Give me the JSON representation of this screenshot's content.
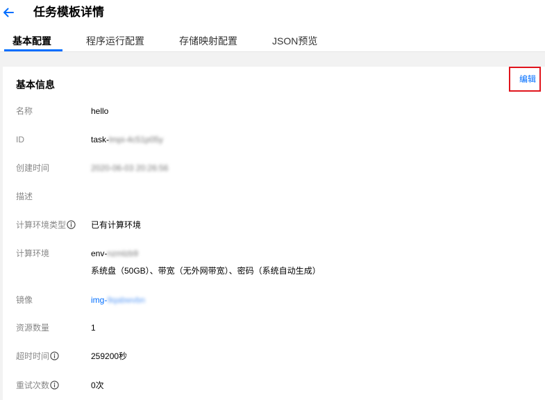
{
  "header": {
    "title": "任务模板详情"
  },
  "tabs": [
    {
      "label": "基本配置",
      "active": true
    },
    {
      "label": "程序运行配置",
      "active": false
    },
    {
      "label": "存储映射配置",
      "active": false
    },
    {
      "label": "JSON预览",
      "active": false
    }
  ],
  "card": {
    "section_title": "基本信息",
    "edit_label": "编辑",
    "fields": {
      "name": {
        "label": "名称",
        "value": "hello"
      },
      "id": {
        "label": "ID",
        "prefix": "task-",
        "masked": "lmpi-4c51p05y"
      },
      "created": {
        "label": "创建时间",
        "masked": "2020-06-03 20:26:56"
      },
      "description": {
        "label": "描述",
        "value": ""
      },
      "env_type": {
        "label": "计算环境类型",
        "value": "已有计算环境"
      },
      "env": {
        "label": "计算环境",
        "prefix": "env-",
        "masked": "nzmlzb9",
        "detail": "系统盘（50GB）、带宽（无外网带宽）、密码（系统自动生成）"
      },
      "image": {
        "label": "镜像",
        "prefix": "img-",
        "masked": "9qabwvbn"
      },
      "resource_count": {
        "label": "资源数量",
        "value": "1"
      },
      "timeout": {
        "label": "超时时间",
        "value": "259200秒"
      },
      "retries": {
        "label": "重试次数",
        "value": "0次"
      }
    }
  },
  "colors": {
    "accent": "#006eff",
    "highlight_border": "#e0141c",
    "label_gray": "#888888",
    "page_bg": "#f2f2f2"
  },
  "icons": {
    "back": "arrow-left-icon",
    "info": "info-circle-icon"
  }
}
